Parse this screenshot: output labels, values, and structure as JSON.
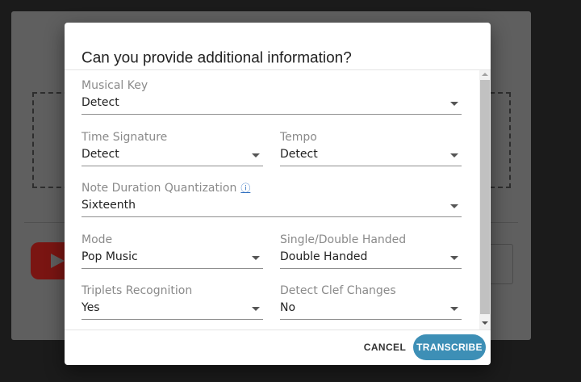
{
  "dialog": {
    "title": "Can you provide additional information?",
    "info_icon": "info-icon",
    "fields": {
      "musical_key": {
        "label": "Musical Key",
        "value": "Detect"
      },
      "time_signature": {
        "label": "Time Signature",
        "value": "Detect"
      },
      "tempo": {
        "label": "Tempo",
        "value": "Detect"
      },
      "note_duration": {
        "label": "Note Duration Quantization",
        "value": "Sixteenth"
      },
      "mode": {
        "label": "Mode",
        "value": "Pop Music"
      },
      "handed": {
        "label": "Single/Double Handed",
        "value": "Double Handed"
      },
      "triplets": {
        "label": "Triplets Recognition",
        "value": "Yes"
      },
      "clef_changes": {
        "label": "Detect Clef Changes",
        "value": "No"
      }
    },
    "buttons": {
      "cancel": "CANCEL",
      "transcribe": "TRANSCRIBE"
    }
  },
  "colors": {
    "accent": "#3d8fb6",
    "info_link": "#2f6fbf",
    "overlay": "#1b1b1b"
  }
}
